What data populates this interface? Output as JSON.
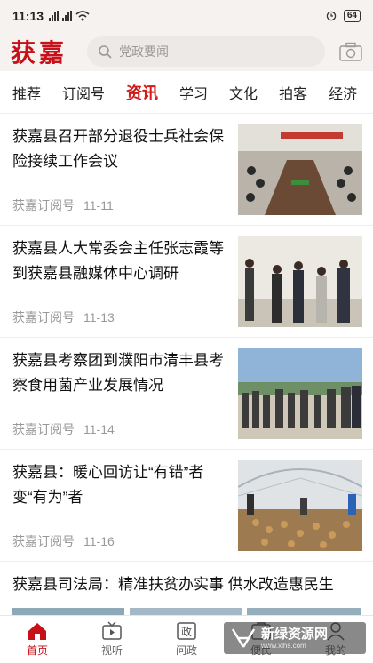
{
  "status": {
    "time": "11:13",
    "battery": "64"
  },
  "header": {
    "logo": "获嘉",
    "search_placeholder": "党政要闻"
  },
  "tabs": [
    "推荐",
    "订阅号",
    "资讯",
    "学习",
    "文化",
    "拍客",
    "经济"
  ],
  "active_tab": "资讯",
  "articles": [
    {
      "title": "获嘉县召开部分退役士兵社会保险接续工作会议",
      "source": "获嘉订阅号",
      "date": "11-11",
      "thumb": "meeting-room"
    },
    {
      "title": "获嘉县人大常委会主任张志霞等到获嘉县融媒体中心调研",
      "source": "获嘉订阅号",
      "date": "11-13",
      "thumb": "visit-group"
    },
    {
      "title": "获嘉县考察团到濮阳市清丰县考察食用菌产业发展情况",
      "source": "获嘉订阅号",
      "date": "11-14",
      "thumb": "outdoor-group"
    },
    {
      "title": "获嘉县：暖心回访让“有错”者变“有为”者",
      "source": "获嘉订阅号",
      "date": "11-16",
      "thumb": "greenhouse"
    },
    {
      "title": "获嘉县司法局：精准扶贫办实事 供水改造惠民生"
    }
  ],
  "bottom_nav": [
    {
      "label": "首页",
      "icon": "home-icon"
    },
    {
      "label": "视听",
      "icon": "tv-icon"
    },
    {
      "label": "问政",
      "icon": "gov-icon"
    },
    {
      "label": "便民",
      "icon": "service-icon"
    },
    {
      "label": "我的",
      "icon": "user-icon"
    }
  ],
  "watermark": {
    "title": "新绿资源网",
    "url": "www.xlhs.com"
  },
  "colors": {
    "accent": "#c8101a",
    "tab_active": "#d21818",
    "meta": "#999999"
  }
}
